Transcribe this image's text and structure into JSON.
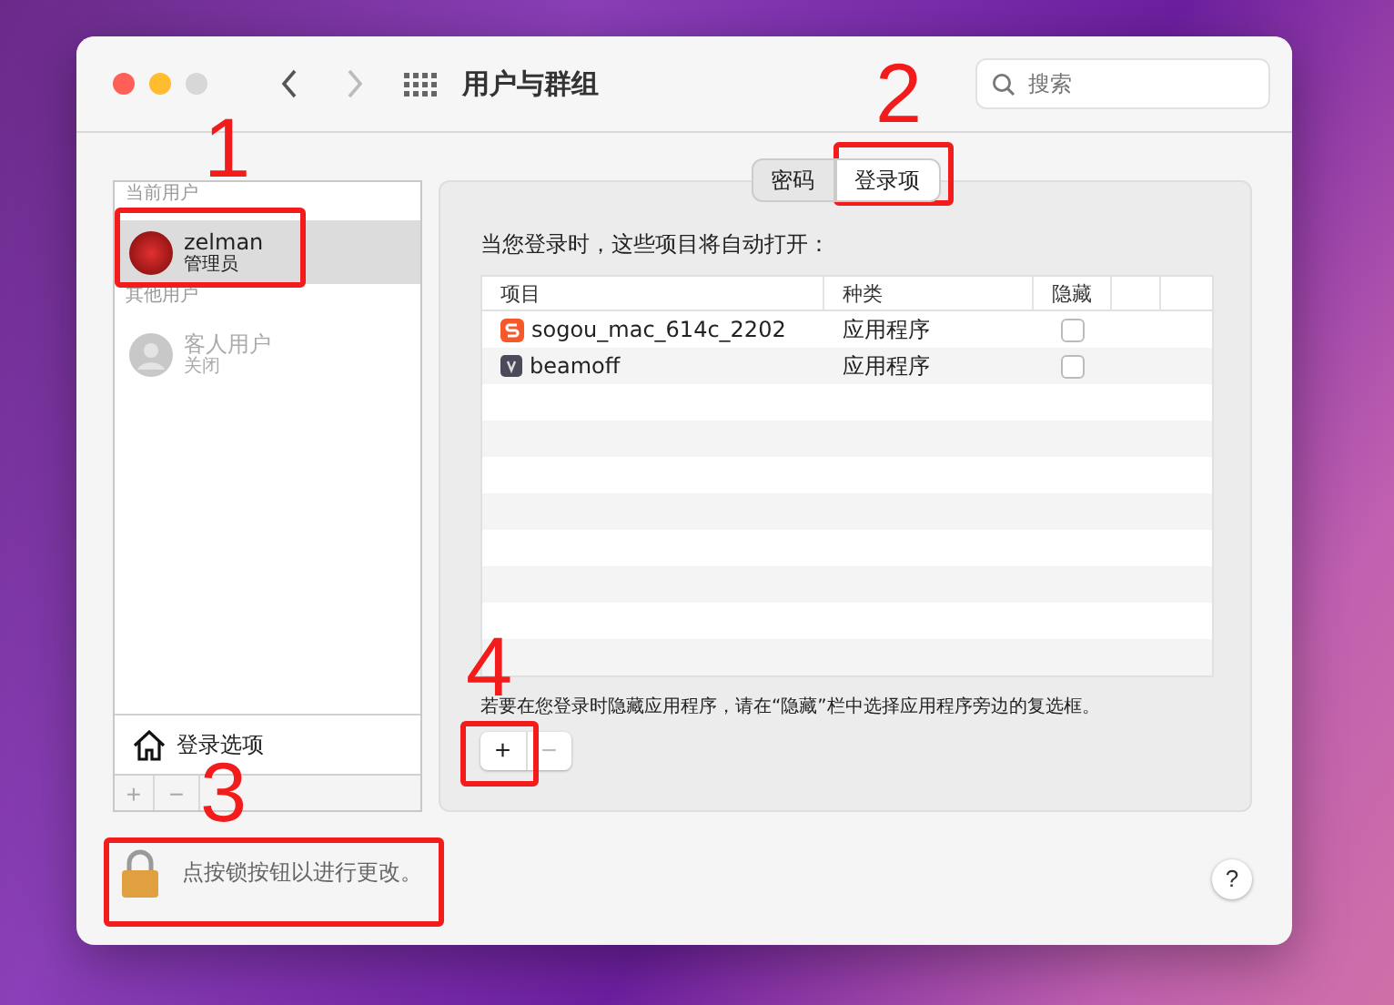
{
  "window": {
    "title": "用户与群组",
    "search": {
      "placeholder": "搜索"
    }
  },
  "sidebar": {
    "sections": [
      {
        "heading": "当前用户",
        "users": [
          {
            "name": "zelman",
            "role": "管理员",
            "selected": true,
            "disabled": false,
            "kind": "photo"
          }
        ]
      },
      {
        "heading": "其他用户",
        "users": [
          {
            "name": "客人用户",
            "role": "关闭",
            "selected": false,
            "disabled": true,
            "kind": "generic"
          }
        ]
      }
    ],
    "login_options": "登录选项",
    "add": "+",
    "remove": "−"
  },
  "tabs": [
    {
      "label": "密码",
      "selected": false
    },
    {
      "label": "登录项",
      "selected": true
    }
  ],
  "login_items": {
    "intro": "当您登录时，这些项目将自动打开：",
    "columns": [
      "项目",
      "种类",
      "隐藏"
    ],
    "rows": [
      {
        "kind": "sogou",
        "item": "sogou_mac_614c_2202",
        "type": "应用程序",
        "hidden": false
      },
      {
        "kind": "generic",
        "item": "beamoff",
        "type": "应用程序",
        "hidden": false
      }
    ],
    "note": "若要在您登录时隐藏应用程序，请在“隐藏”栏中选择应用程序旁边的复选框。",
    "add": "+",
    "remove": "−"
  },
  "lock": {
    "text": "点按锁按钮以进行更改。"
  },
  "help": "?",
  "annotations": [
    {
      "label": "1"
    },
    {
      "label": "2"
    },
    {
      "label": "3"
    },
    {
      "label": "4"
    }
  ]
}
